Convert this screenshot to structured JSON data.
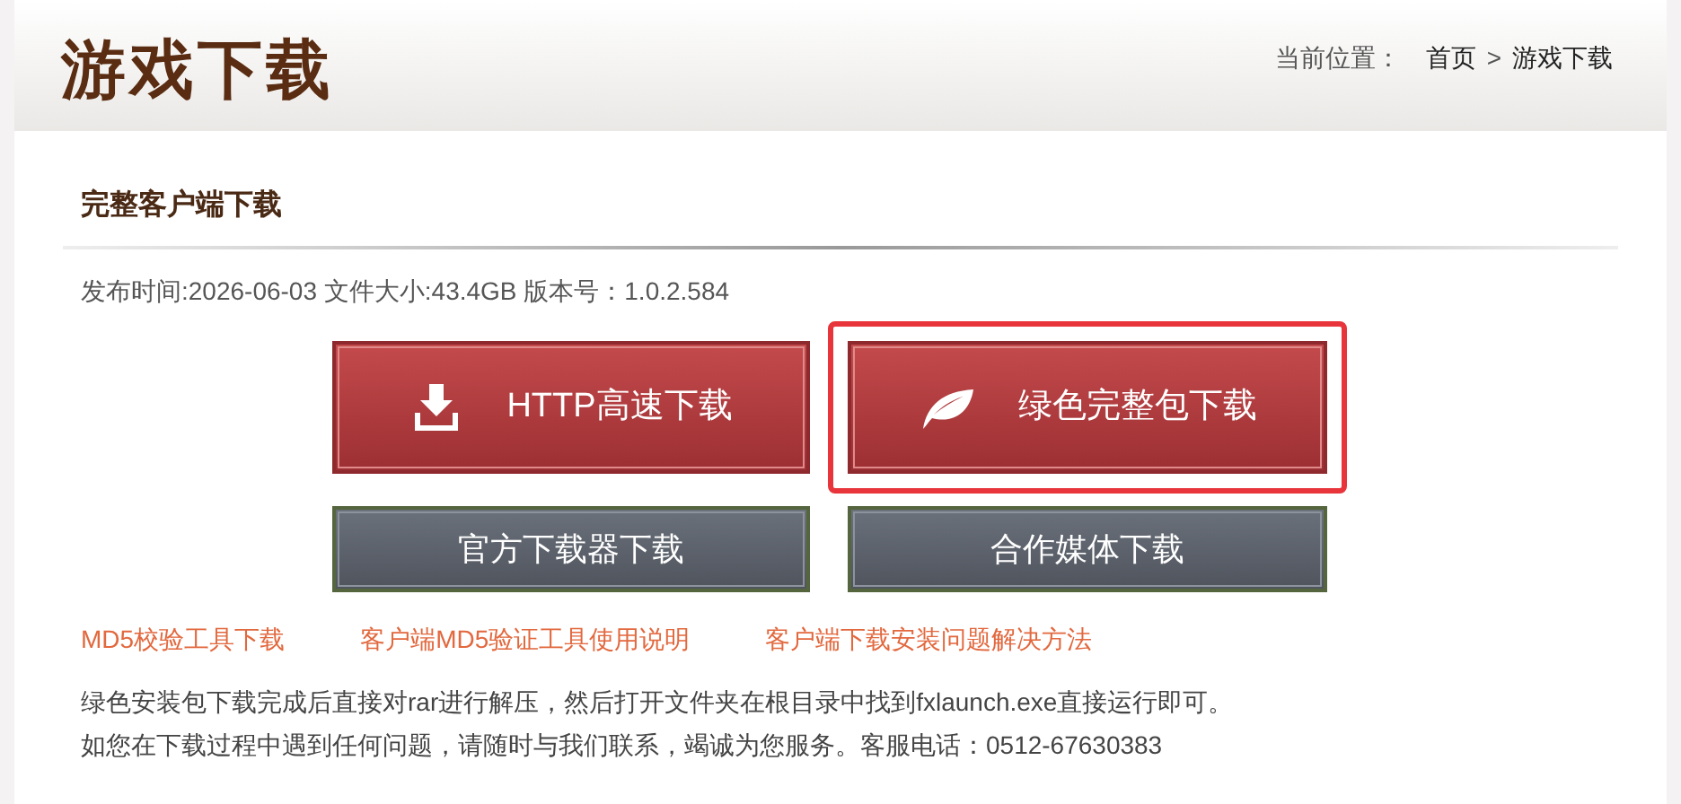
{
  "header": {
    "title": "游戏下载",
    "breadcrumb": {
      "label": "当前位置：",
      "items": [
        "首页",
        "游戏下载"
      ],
      "separator": ">"
    }
  },
  "section": {
    "title": "完整客户端下载",
    "meta": "发布时间:2026-06-03 文件大小:43.4GB 版本号：1.0.2.584"
  },
  "buttons": [
    {
      "label": "HTTP高速下载",
      "kind": "primary",
      "highlighted": false
    },
    {
      "label": "绿色完整包下载",
      "kind": "primary",
      "highlighted": true
    },
    {
      "label": "官方下载器下载",
      "kind": "secondary",
      "highlighted": false
    },
    {
      "label": "合作媒体下载",
      "kind": "secondary",
      "highlighted": false
    }
  ],
  "links": [
    "MD5校验工具下载",
    "客户端MD5验证工具使用说明",
    "客户端下载安装问题解决方法"
  ],
  "notes": [
    "绿色安装包下载完成后直接对rar进行解压，然后打开文件夹在根目录中找到fxlaunch.exe直接运行即可。",
    "如您在下载过程中遇到任何问题，请随时与我们联系，竭诚为您服务。客服电话：0512-67630383"
  ]
}
